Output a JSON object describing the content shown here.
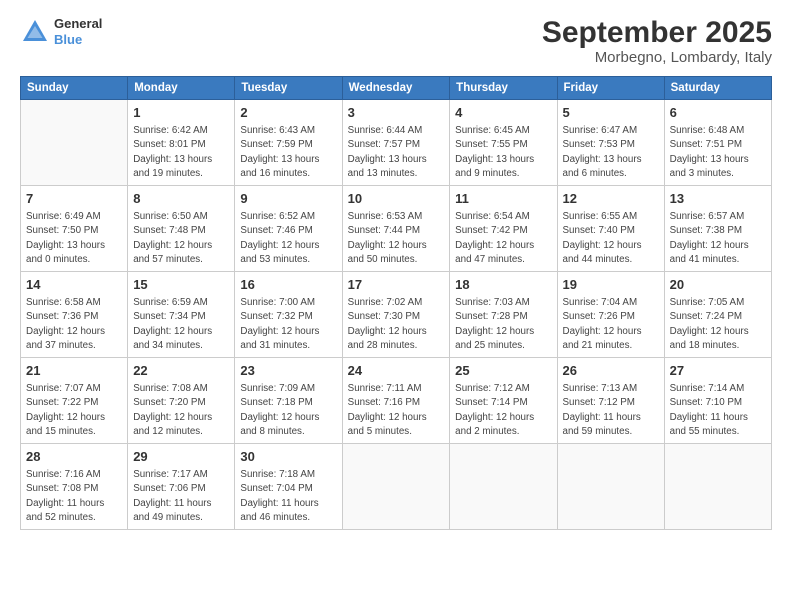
{
  "logo": {
    "line1": "General",
    "line2": "Blue"
  },
  "title": "September 2025",
  "subtitle": "Morbegno, Lombardy, Italy",
  "days_of_week": [
    "Sunday",
    "Monday",
    "Tuesday",
    "Wednesday",
    "Thursday",
    "Friday",
    "Saturday"
  ],
  "weeks": [
    [
      {
        "day": "",
        "info": ""
      },
      {
        "day": "1",
        "info": "Sunrise: 6:42 AM\nSunset: 8:01 PM\nDaylight: 13 hours\nand 19 minutes."
      },
      {
        "day": "2",
        "info": "Sunrise: 6:43 AM\nSunset: 7:59 PM\nDaylight: 13 hours\nand 16 minutes."
      },
      {
        "day": "3",
        "info": "Sunrise: 6:44 AM\nSunset: 7:57 PM\nDaylight: 13 hours\nand 13 minutes."
      },
      {
        "day": "4",
        "info": "Sunrise: 6:45 AM\nSunset: 7:55 PM\nDaylight: 13 hours\nand 9 minutes."
      },
      {
        "day": "5",
        "info": "Sunrise: 6:47 AM\nSunset: 7:53 PM\nDaylight: 13 hours\nand 6 minutes."
      },
      {
        "day": "6",
        "info": "Sunrise: 6:48 AM\nSunset: 7:51 PM\nDaylight: 13 hours\nand 3 minutes."
      }
    ],
    [
      {
        "day": "7",
        "info": "Sunrise: 6:49 AM\nSunset: 7:50 PM\nDaylight: 13 hours\nand 0 minutes."
      },
      {
        "day": "8",
        "info": "Sunrise: 6:50 AM\nSunset: 7:48 PM\nDaylight: 12 hours\nand 57 minutes."
      },
      {
        "day": "9",
        "info": "Sunrise: 6:52 AM\nSunset: 7:46 PM\nDaylight: 12 hours\nand 53 minutes."
      },
      {
        "day": "10",
        "info": "Sunrise: 6:53 AM\nSunset: 7:44 PM\nDaylight: 12 hours\nand 50 minutes."
      },
      {
        "day": "11",
        "info": "Sunrise: 6:54 AM\nSunset: 7:42 PM\nDaylight: 12 hours\nand 47 minutes."
      },
      {
        "day": "12",
        "info": "Sunrise: 6:55 AM\nSunset: 7:40 PM\nDaylight: 12 hours\nand 44 minutes."
      },
      {
        "day": "13",
        "info": "Sunrise: 6:57 AM\nSunset: 7:38 PM\nDaylight: 12 hours\nand 41 minutes."
      }
    ],
    [
      {
        "day": "14",
        "info": "Sunrise: 6:58 AM\nSunset: 7:36 PM\nDaylight: 12 hours\nand 37 minutes."
      },
      {
        "day": "15",
        "info": "Sunrise: 6:59 AM\nSunset: 7:34 PM\nDaylight: 12 hours\nand 34 minutes."
      },
      {
        "day": "16",
        "info": "Sunrise: 7:00 AM\nSunset: 7:32 PM\nDaylight: 12 hours\nand 31 minutes."
      },
      {
        "day": "17",
        "info": "Sunrise: 7:02 AM\nSunset: 7:30 PM\nDaylight: 12 hours\nand 28 minutes."
      },
      {
        "day": "18",
        "info": "Sunrise: 7:03 AM\nSunset: 7:28 PM\nDaylight: 12 hours\nand 25 minutes."
      },
      {
        "day": "19",
        "info": "Sunrise: 7:04 AM\nSunset: 7:26 PM\nDaylight: 12 hours\nand 21 minutes."
      },
      {
        "day": "20",
        "info": "Sunrise: 7:05 AM\nSunset: 7:24 PM\nDaylight: 12 hours\nand 18 minutes."
      }
    ],
    [
      {
        "day": "21",
        "info": "Sunrise: 7:07 AM\nSunset: 7:22 PM\nDaylight: 12 hours\nand 15 minutes."
      },
      {
        "day": "22",
        "info": "Sunrise: 7:08 AM\nSunset: 7:20 PM\nDaylight: 12 hours\nand 12 minutes."
      },
      {
        "day": "23",
        "info": "Sunrise: 7:09 AM\nSunset: 7:18 PM\nDaylight: 12 hours\nand 8 minutes."
      },
      {
        "day": "24",
        "info": "Sunrise: 7:11 AM\nSunset: 7:16 PM\nDaylight: 12 hours\nand 5 minutes."
      },
      {
        "day": "25",
        "info": "Sunrise: 7:12 AM\nSunset: 7:14 PM\nDaylight: 12 hours\nand 2 minutes."
      },
      {
        "day": "26",
        "info": "Sunrise: 7:13 AM\nSunset: 7:12 PM\nDaylight: 11 hours\nand 59 minutes."
      },
      {
        "day": "27",
        "info": "Sunrise: 7:14 AM\nSunset: 7:10 PM\nDaylight: 11 hours\nand 55 minutes."
      }
    ],
    [
      {
        "day": "28",
        "info": "Sunrise: 7:16 AM\nSunset: 7:08 PM\nDaylight: 11 hours\nand 52 minutes."
      },
      {
        "day": "29",
        "info": "Sunrise: 7:17 AM\nSunset: 7:06 PM\nDaylight: 11 hours\nand 49 minutes."
      },
      {
        "day": "30",
        "info": "Sunrise: 7:18 AM\nSunset: 7:04 PM\nDaylight: 11 hours\nand 46 minutes."
      },
      {
        "day": "",
        "info": ""
      },
      {
        "day": "",
        "info": ""
      },
      {
        "day": "",
        "info": ""
      },
      {
        "day": "",
        "info": ""
      }
    ]
  ]
}
